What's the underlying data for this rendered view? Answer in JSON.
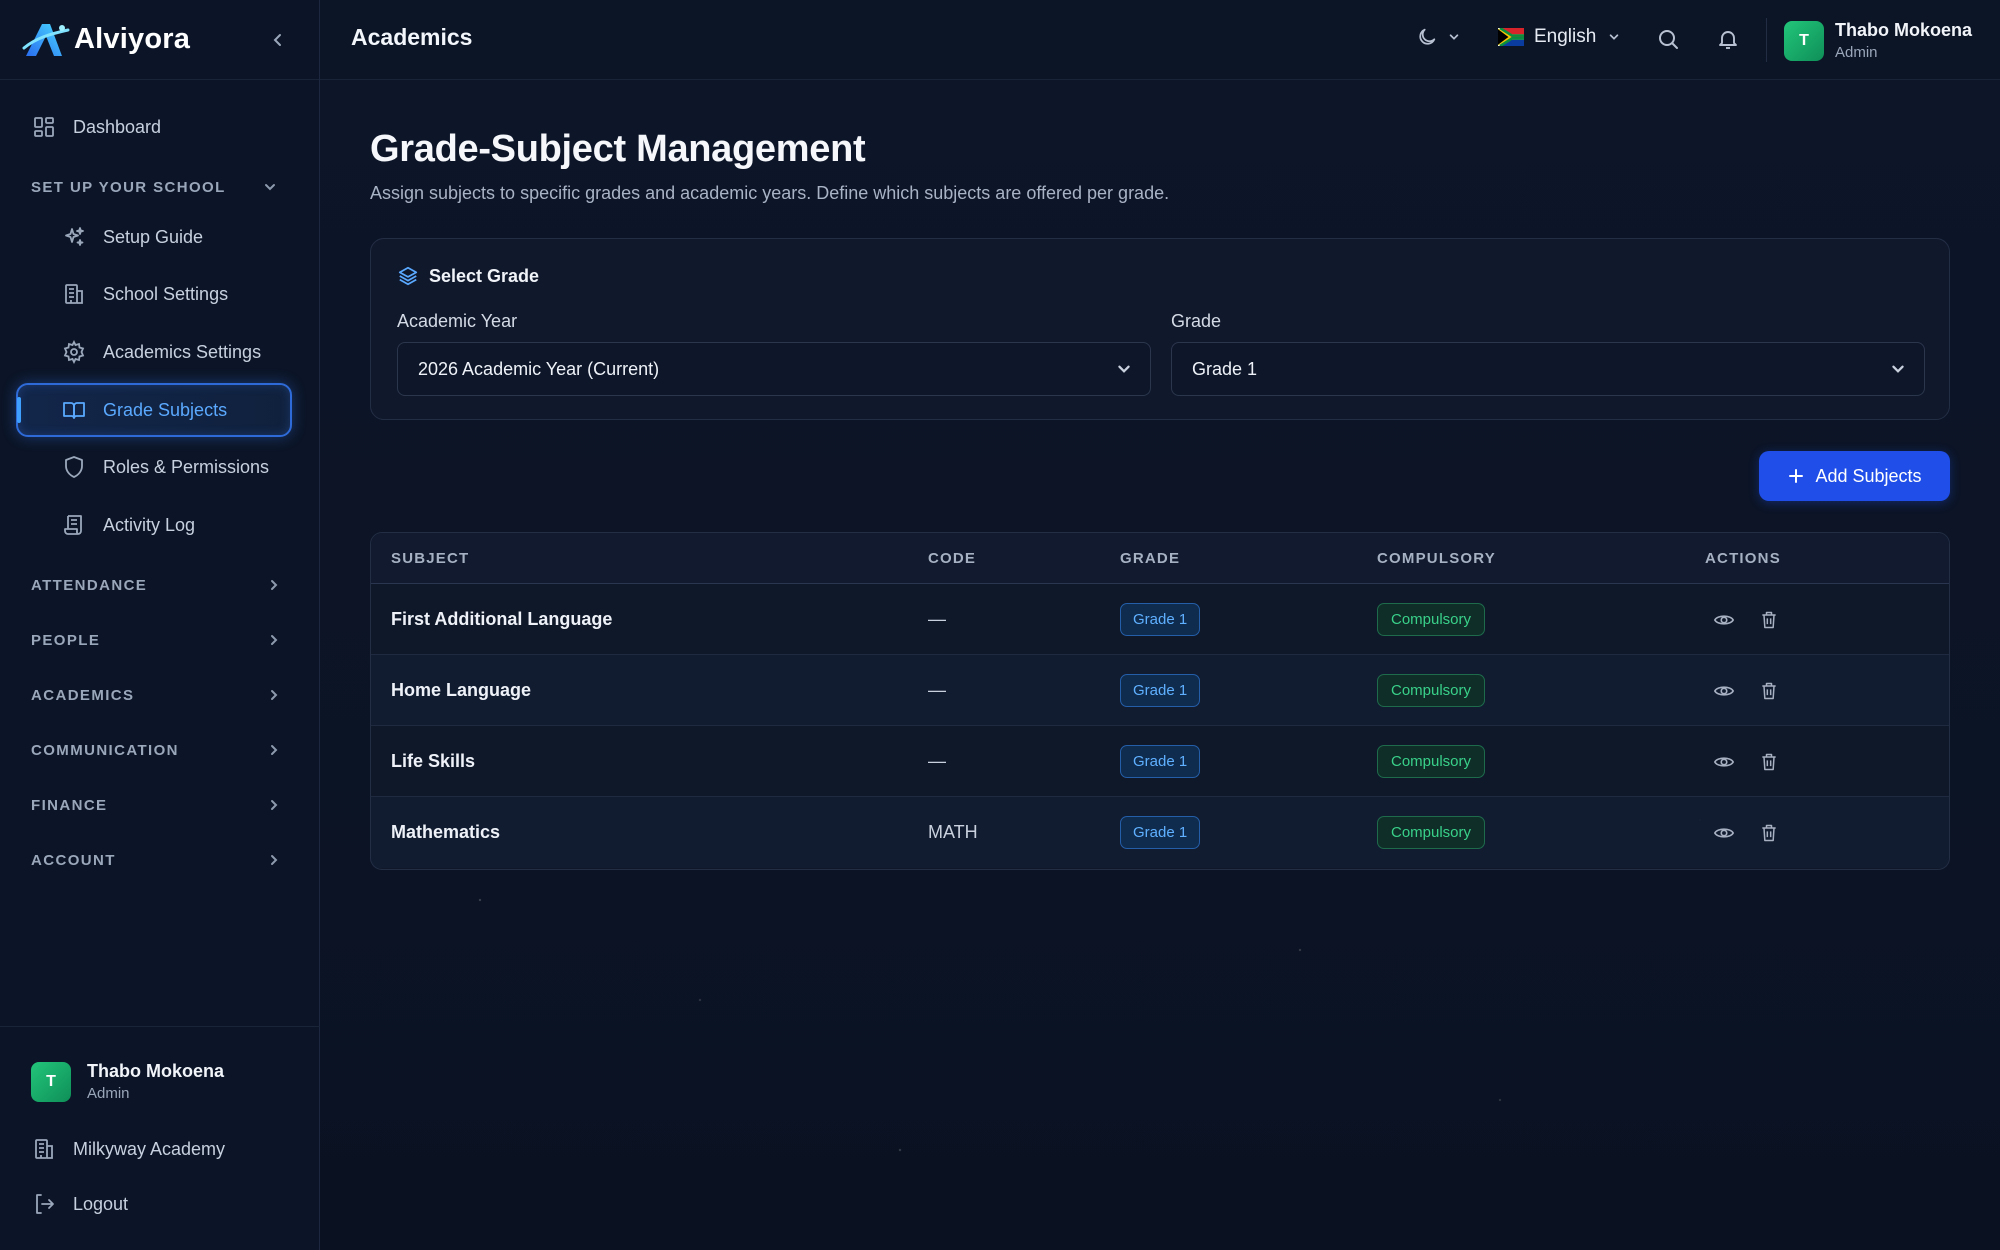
{
  "app": {
    "name": "Alviyora"
  },
  "sidebar": {
    "dashboard": "Dashboard",
    "setup_section": "SET UP YOUR SCHOOL",
    "setup_items": [
      {
        "label": "Setup Guide",
        "icon": "sparkles-icon"
      },
      {
        "label": "School Settings",
        "icon": "building-icon"
      },
      {
        "label": "Academics Settings",
        "icon": "gear-icon"
      },
      {
        "label": "Grade Subjects",
        "icon": "book-open-icon",
        "active": true
      },
      {
        "label": "Roles & Permissions",
        "icon": "shield-icon"
      },
      {
        "label": "Activity Log",
        "icon": "scroll-icon"
      }
    ],
    "sections": [
      "ATTENDANCE",
      "PEOPLE",
      "ACADEMICS",
      "COMMUNICATION",
      "FINANCE",
      "ACCOUNT"
    ],
    "user": {
      "initial": "T",
      "name": "Thabo Mokoena",
      "role": "Admin"
    },
    "school": "Milkyway Academy",
    "logout": "Logout"
  },
  "header": {
    "title": "Academics",
    "language": "English",
    "user": {
      "initial": "T",
      "name": "Thabo Mokoena",
      "role": "Admin"
    }
  },
  "main": {
    "title": "Grade-Subject Management",
    "subtitle": "Assign subjects to specific grades and academic years. Define which subjects are offered per grade.",
    "select_card": {
      "title": "Select Grade",
      "academic_year_label": "Academic Year",
      "academic_year_value": "2026 Academic Year (Current)",
      "grade_label": "Grade",
      "grade_value": "Grade 1"
    },
    "add_button": "Add Subjects",
    "table": {
      "headers": [
        "SUBJECT",
        "CODE",
        "GRADE",
        "COMPULSORY",
        "ACTIONS"
      ],
      "rows": [
        {
          "subject": "First Additional Language",
          "code": "—",
          "grade": "Grade 1",
          "compulsory": "Compulsory"
        },
        {
          "subject": "Home Language",
          "code": "—",
          "grade": "Grade 1",
          "compulsory": "Compulsory"
        },
        {
          "subject": "Life Skills",
          "code": "—",
          "grade": "Grade 1",
          "compulsory": "Compulsory"
        },
        {
          "subject": "Mathematics",
          "code": "MATH",
          "grade": "Grade 1",
          "compulsory": "Compulsory"
        }
      ]
    }
  },
  "colors": {
    "accent": "#1f4fe8",
    "active_nav": "#3fa0ff",
    "compulsory": "#39d08a",
    "grade_badge": "#5fb0ff",
    "background": "#0b1324"
  }
}
